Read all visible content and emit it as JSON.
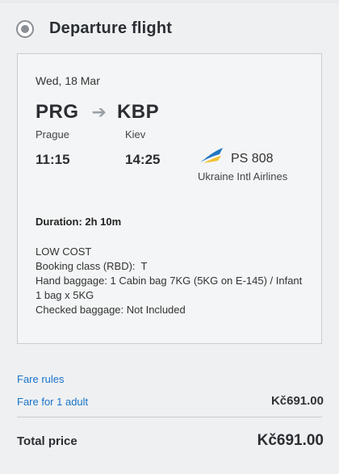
{
  "section": {
    "title": "Departure flight"
  },
  "flight": {
    "date": "Wed, 18 Mar",
    "from_code": "PRG",
    "to_code": "KBP",
    "from_city": "Prague",
    "to_city": "Kiev",
    "depart_time": "11:15",
    "arrive_time": "14:25",
    "flight_number": "PS 808",
    "airline_name": "Ukraine Intl Airlines",
    "airline_logo_icon": "ukraine-intl-airlines-logo-icon",
    "duration": "Duration: 2h 10m",
    "fare_type": "LOW COST",
    "booking_class": "Booking class (RBD):  T",
    "hand_baggage": "Hand baggage: 1 Cabin bag 7KG (5KG on E-145) / Infant 1 bag x 5KG",
    "checked_baggage": "Checked baggage: Not Included"
  },
  "fare": {
    "rules_label": "Fare rules",
    "adult_label": "Fare for 1 adult",
    "adult_price": "Kč691.00"
  },
  "total": {
    "label": "Total price",
    "price": "Kč691.00"
  },
  "colors": {
    "link": "#1a73c9",
    "logo_blue": "#1f75c2",
    "logo_yellow": "#f2c12e"
  }
}
